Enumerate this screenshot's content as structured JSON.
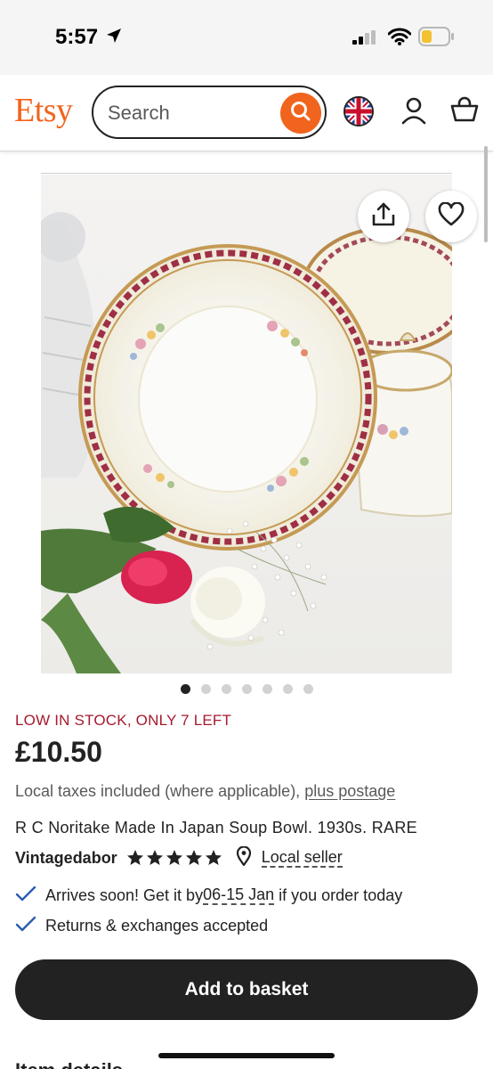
{
  "status_bar": {
    "time": "5:57"
  },
  "header": {
    "logo": "Etsy",
    "search_placeholder": "Search"
  },
  "listing": {
    "stock_notice": "LOW IN STOCK, ONLY 7 LEFT",
    "price": "£10.50",
    "taxes_text": "Local taxes included (where applicable), ",
    "postage_link": "plus postage",
    "title": "R C Noritake Made In Japan Soup Bowl. 1930s. RARE",
    "seller_name": "Vintagedabor",
    "rating_stars": 5,
    "local_seller": "Local seller",
    "image_count": 7,
    "active_image": 0
  },
  "delivery": {
    "arrives_prefix": "Arrives soon! Get it by ",
    "arrives_dates": "06-15 Jan",
    "arrives_suffix": " if you order today",
    "returns": "Returns & exchanges accepted"
  },
  "actions": {
    "add_to_basket": "Add to basket"
  },
  "next_section": "Item details",
  "colors": {
    "brand": "#F1641E",
    "stock_alert": "#A61A2E",
    "button": "#222222"
  }
}
